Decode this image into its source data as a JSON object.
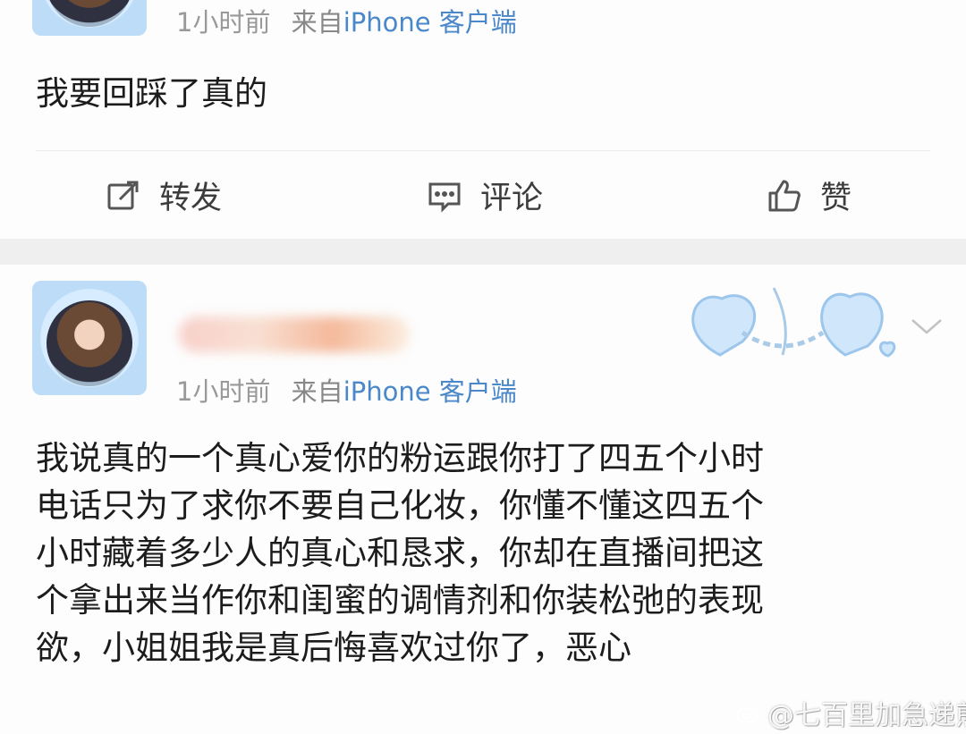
{
  "posts": [
    {
      "time": "1小时前",
      "source_prefix": "来自",
      "device": "iPhone 客户端",
      "text": "我要回踩了真的",
      "actions": {
        "repost": "转发",
        "comment": "评论",
        "like": "赞"
      }
    },
    {
      "time": "1小时前",
      "source_prefix": "来自",
      "device": "iPhone 客户端",
      "text_lines": [
        "我说真的一个真心爱你的粉运跟你打了四五个小时",
        "电话只为了求你不要自己化妆，你懂不懂这四五个",
        "小时藏着多少人的真心和恳求，你却在直播间把这",
        "个拿出来当作你和闺蜜的调情剂和你装松弛的表现",
        "欲，小姐姐我是真后悔喜欢过你了，恶心"
      ]
    }
  ],
  "watermark": {
    "text": "@七百里加急递煎饼"
  },
  "icons": [
    "repost-icon",
    "comment-icon",
    "like-icon",
    "chevron-down-icon",
    "weibo-logo-icon"
  ],
  "colors": {
    "device_link": "#4b88c9",
    "meta_gray": "#999999",
    "separator": "#efefef"
  }
}
